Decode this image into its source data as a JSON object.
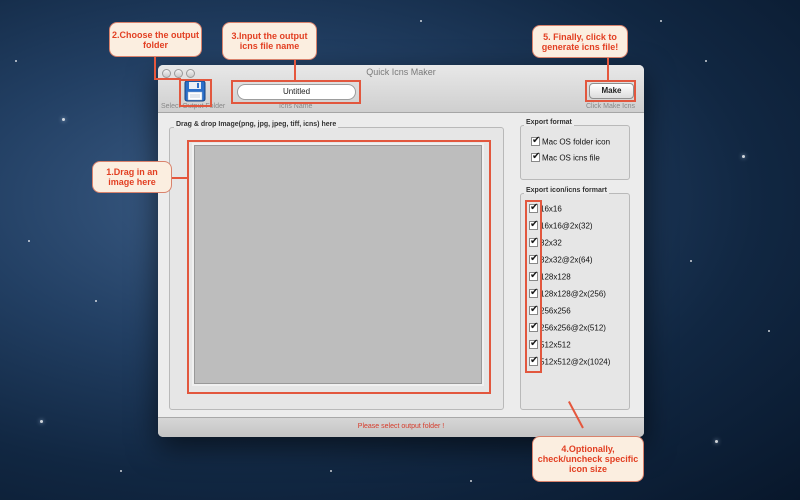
{
  "window": {
    "title": "Quick Icns Maker",
    "status": "Please select output folder !"
  },
  "toolbar": {
    "select_output_caption": "Select Output Folder",
    "icns_name_value": "Untitled",
    "icns_name_caption": "Icns Name",
    "make_label": "Make",
    "make_caption": "Click Make Icns"
  },
  "drop": {
    "title": "Drag & drop Image(png, jpg, jpeg, tiff, icns) here"
  },
  "export_format": {
    "title": "Export format",
    "options": [
      {
        "label": "Mac OS folder icon",
        "checked": true
      },
      {
        "label": "Mac OS icns file",
        "checked": true
      }
    ]
  },
  "export_sizes": {
    "title": "Export icon/icns formart",
    "options": [
      {
        "label": "16x16",
        "checked": true
      },
      {
        "label": "16x16@2x(32)",
        "checked": true
      },
      {
        "label": "32x32",
        "checked": true
      },
      {
        "label": "32x32@2x(64)",
        "checked": true
      },
      {
        "label": "128x128",
        "checked": true
      },
      {
        "label": "128x128@2x(256)",
        "checked": true
      },
      {
        "label": "256x256",
        "checked": true
      },
      {
        "label": "256x256@2x(512)",
        "checked": true
      },
      {
        "label": "512x512",
        "checked": true
      },
      {
        "label": "512x512@2x(1024)",
        "checked": true
      }
    ]
  },
  "callouts": {
    "choose_folder": "2.Choose the output folder",
    "input_name": "3.Input the output icns file name",
    "make": "5. Finally, click to generate icns file!",
    "drag": "1.Drag in an image here",
    "optional": "4.Optionally, check/uncheck specific icon size"
  },
  "colors": {
    "accent": "#e23f22",
    "highlight_border": "#e2573e",
    "callout_bg": "#fbeee0",
    "status_text": "#d63b2a"
  },
  "icons": {
    "save": "floppy-disk-icon"
  }
}
